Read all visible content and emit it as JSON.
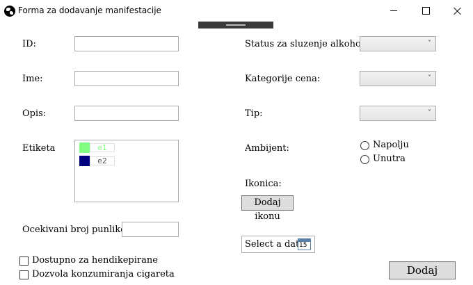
{
  "window": {
    "title": "Forma za dodavanje manifestacije",
    "controls": {
      "minimize": "minimize",
      "maximize": "maximize",
      "close": "close"
    }
  },
  "form": {
    "id_label": "ID:",
    "ime_label": "Ime:",
    "opis_label": "Opis:",
    "etiketa_label": "Etiketa",
    "etikete": [
      {
        "label": "e1",
        "color": "#80ff80"
      },
      {
        "label": "e2",
        "color": "#000080"
      }
    ],
    "broj_label": "Ocekivani broj punlike:",
    "dostupno_label": "Dostupno za hendikepirane",
    "cigarete_label": "Dozvola konzumiranja cigareta",
    "status_label": "Status za sluzenje alkohola:",
    "kategorije_label": "Kategorije cena:",
    "tip_label": "Tip:",
    "ambijent_label": "Ambijent:",
    "napolju_label": "Napolju",
    "unutra_label": "Unutra",
    "ikonica_label": "Ikonica:",
    "dodaj_ikonu_label": "Dodaj ikonu",
    "date_placeholder": "Select a date",
    "calendar_day": "15",
    "submit_label": "Dodaj"
  }
}
